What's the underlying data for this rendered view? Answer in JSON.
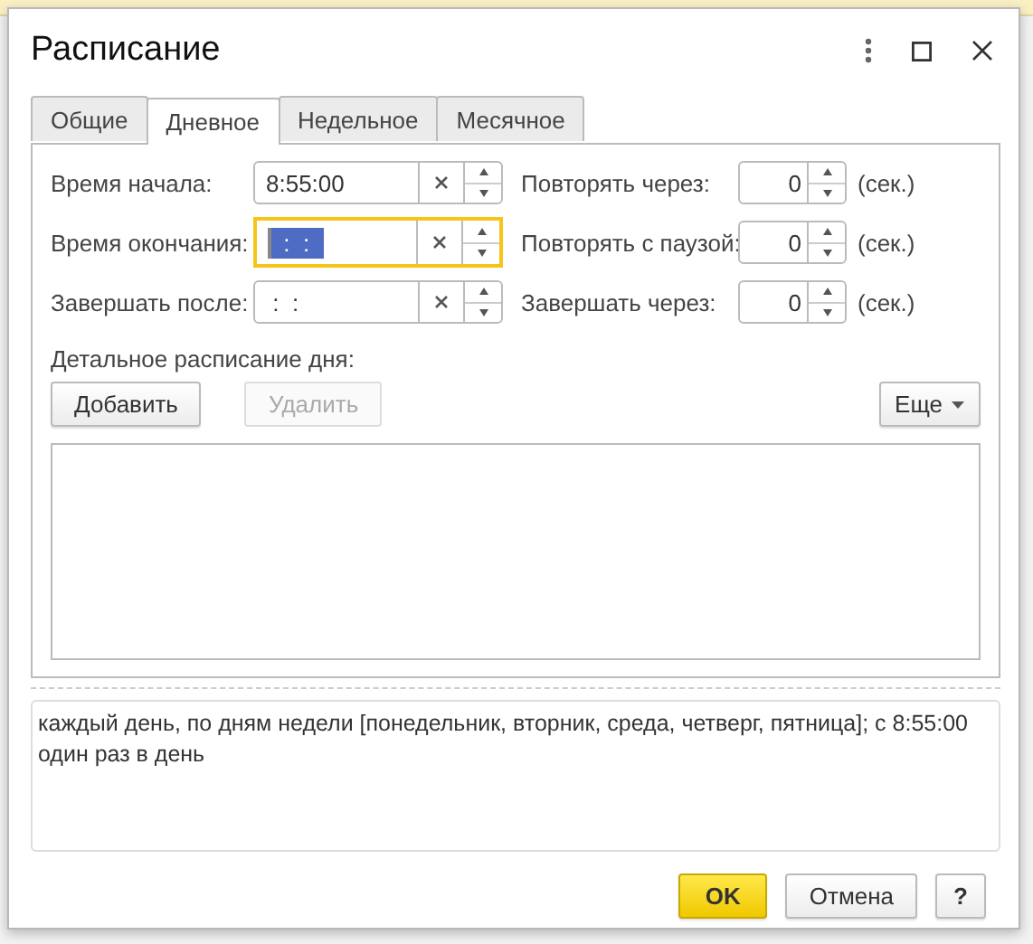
{
  "window": {
    "title": "Расписание"
  },
  "tabs": [
    {
      "label": "Общие",
      "selected": false
    },
    {
      "label": "Дневное",
      "selected": true
    },
    {
      "label": "Недельное",
      "selected": false
    },
    {
      "label": "Месячное",
      "selected": false
    }
  ],
  "time_fields": [
    {
      "label": "Время начала:",
      "value": "8:55:00",
      "focused": false
    },
    {
      "label": "Время окончания:",
      "value": " :  : ",
      "focused": true
    },
    {
      "label": "Завершать после:",
      "value": " :  :",
      "focused": false
    }
  ],
  "number_fields": [
    {
      "label": "Повторять через:",
      "value": "0",
      "unit": "(сек.)"
    },
    {
      "label": "Повторять с паузой:",
      "value": "0",
      "unit": "(сек.)"
    },
    {
      "label": "Завершать через:",
      "value": "0",
      "unit": "(сек.)"
    }
  ],
  "detail": {
    "label": "Детальное расписание дня:",
    "buttons": [
      {
        "label": "Добавить",
        "disabled": false
      },
      {
        "label": "Удалить",
        "disabled": true
      }
    ],
    "more_button": "Еще"
  },
  "description": "каждый день, по дням недели [понедельник, вторник, среда, четверг, пятница]; с 8:55:00 один раз в день",
  "footer_buttons": [
    {
      "label": "OK",
      "kind": "default"
    },
    {
      "label": "Отмена",
      "kind": "normal"
    },
    {
      "label": "?",
      "kind": "help"
    }
  ]
}
